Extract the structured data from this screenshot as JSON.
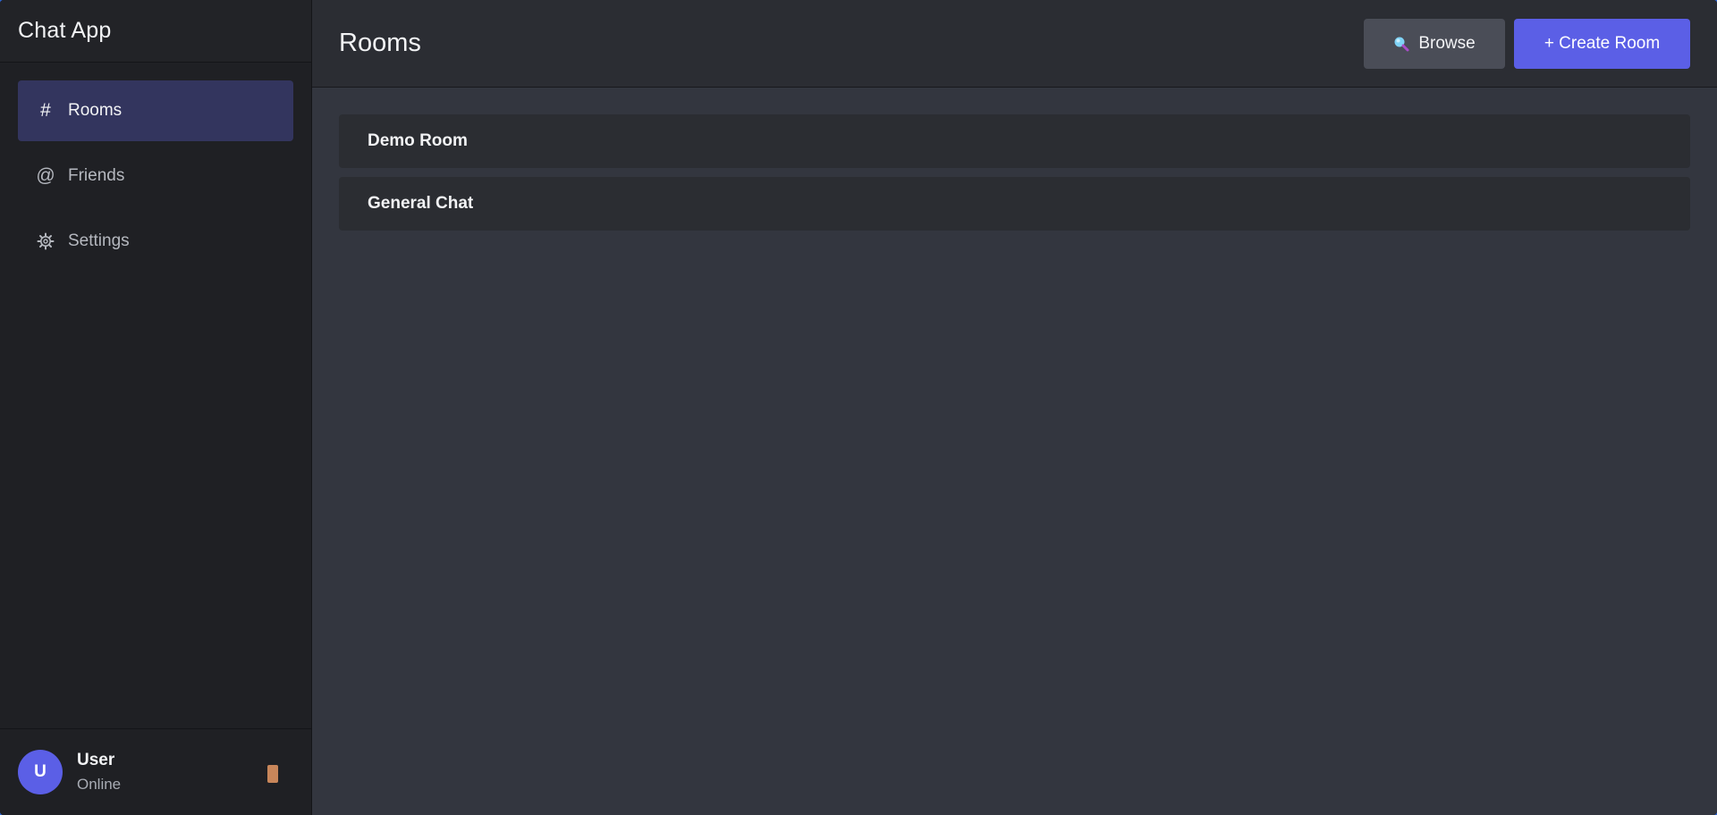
{
  "app": {
    "title": "Chat App"
  },
  "sidebar": {
    "items": [
      {
        "label": "Rooms",
        "icon": "hash-icon",
        "glyph": "#",
        "active": true
      },
      {
        "label": "Friends",
        "icon": "at-icon",
        "glyph": "@",
        "active": false
      },
      {
        "label": "Settings",
        "icon": "gear-icon",
        "glyph": "⚙",
        "active": false
      }
    ]
  },
  "user": {
    "initial": "U",
    "name": "User",
    "status": "Online"
  },
  "main": {
    "title": "Rooms",
    "browse_label": "Browse",
    "create_label": "+ Create Room",
    "rooms": [
      {
        "name": "Demo Room"
      },
      {
        "name": "General Chat"
      }
    ]
  },
  "colors": {
    "accent": "#5b5fe6",
    "sidebar_bg": "#1f2024",
    "main_bg": "#33363f",
    "active_nav_bg": "#33355e"
  }
}
